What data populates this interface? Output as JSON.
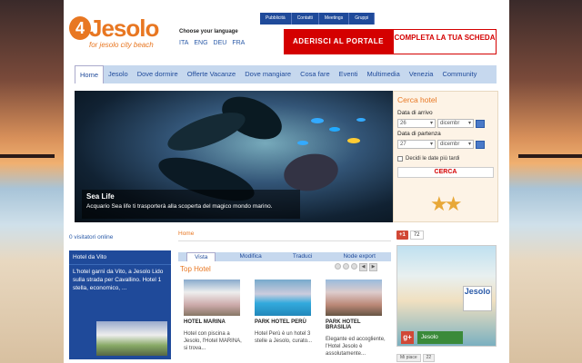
{
  "colors": {
    "brand_orange": "#e87722",
    "nav_blue": "#1f4a9a",
    "accent_red": "#d40000",
    "nav_light": "#c6d8ee"
  },
  "logo": {
    "mark": "4",
    "name": "Jesolo",
    "tagline": "for jesolo city beach"
  },
  "language": {
    "title": "Choose your language",
    "options": [
      "ITA",
      "ENG",
      "DEU",
      "FRA"
    ]
  },
  "top_links": [
    "Pubblicità",
    "Contatti",
    "Meetings",
    "Gruppi"
  ],
  "cta": {
    "adherisci": "ADERISCI AL PORTALE",
    "completa": "COMPLETA LA TUA SCHEDA"
  },
  "nav": {
    "items": [
      "Home",
      "Jesolo",
      "Dove dormire",
      "Offerte Vacanze",
      "Dove mangiare",
      "Cosa fare",
      "Eventi",
      "Multimedia",
      "Venezia",
      "Community"
    ],
    "active_index": 0
  },
  "hero": {
    "title": "Sea Life",
    "description": "Acquario Sea life ti trasporterà alla scoperta del magico mondo marino."
  },
  "cerca": {
    "title": "Cerca hotel",
    "arrival_label": "Data di arrivo",
    "arrival_day": "26",
    "arrival_month": "dicembr",
    "departure_label": "Data di partenza",
    "departure_day": "27",
    "departure_month": "dicembr",
    "later_label": "Decidi le date più tardi",
    "button": "CERCA"
  },
  "visitors": "0 visitatori online",
  "side_hotel": {
    "title": "Hotel da Vito",
    "description": "L'hotel garnì da Vito, a Jesolo Lido sulla strada per Cavallino. Hotel 1 stella, economico, ..."
  },
  "breadcrumb": "Home",
  "tabs": {
    "items": [
      "Vista",
      "Modifica",
      "Traduci",
      "Node export"
    ],
    "active_index": 0
  },
  "top_hotel": {
    "title": "Top Hotel",
    "hotels": [
      {
        "name": "HOTEL MARINA",
        "description": "Hotel con piscina a Jesolo, l'Hotel MARINA, si trova..."
      },
      {
        "name": "PARK HOTEL PERÙ",
        "description": "Hotel Perù è un hotel 3 stelle a Jesolo, curato..."
      },
      {
        "name": "PARK HOTEL BRASILIA",
        "description": "Elegante ed accogliente, l'Hotel Jesolo è assolutamente..."
      }
    ]
  },
  "social": {
    "gplus_label": "+1",
    "gplus_count": "72",
    "promo_badge": "Jesolo",
    "promo_button": "Jesolo",
    "fb_label": "Mi piace",
    "fb_count": "22"
  }
}
